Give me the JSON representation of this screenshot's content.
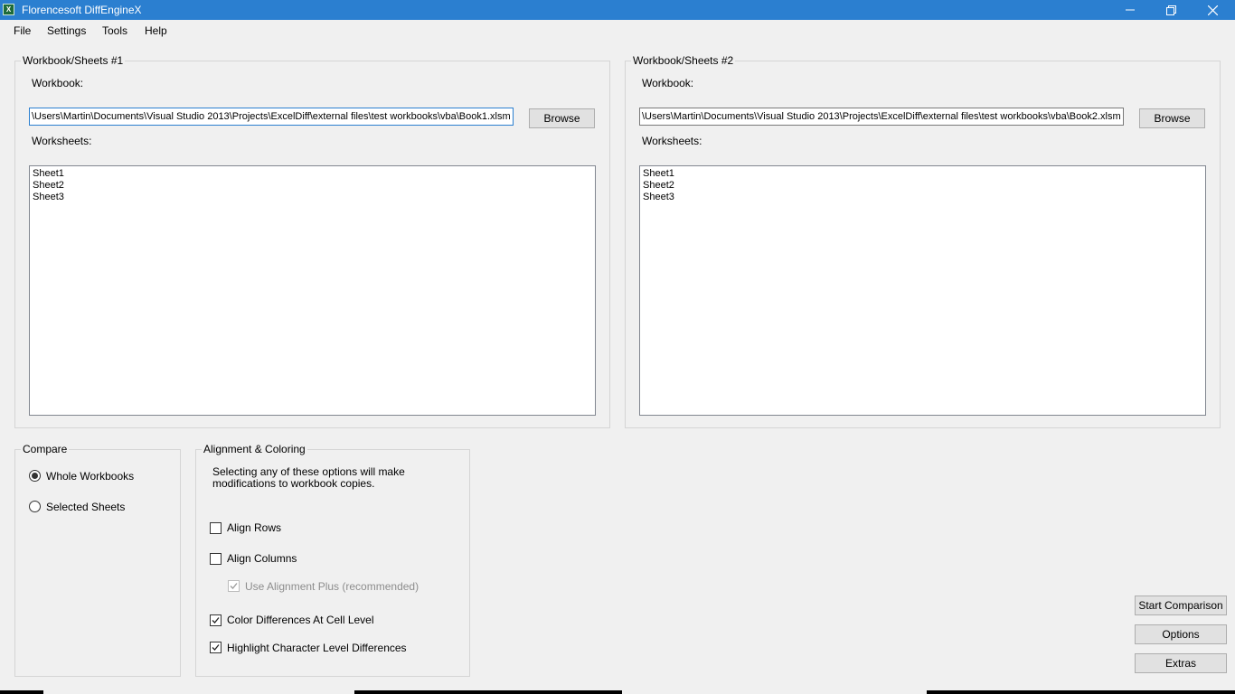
{
  "window": {
    "title": "Florencesoft DiffEngineX",
    "icon_name": "excel-app-icon",
    "controls": [
      "minimize-icon",
      "restore-icon",
      "close-icon"
    ]
  },
  "menu": {
    "items": [
      "File",
      "Settings",
      "Tools",
      "Help"
    ]
  },
  "workbook1": {
    "group_title": "Workbook/Sheets #1",
    "workbook_label": "Workbook:",
    "path": "\\Users\\Martin\\Documents\\Visual Studio 2013\\Projects\\ExcelDiff\\external files\\test workbooks\\vba\\Book1.xlsm",
    "browse_label": "Browse",
    "worksheets_label": "Worksheets:",
    "sheets": [
      "Sheet1",
      "Sheet2",
      "Sheet3"
    ]
  },
  "workbook2": {
    "group_title": "Workbook/Sheets #2",
    "workbook_label": "Workbook:",
    "path": "\\Users\\Martin\\Documents\\Visual Studio 2013\\Projects\\ExcelDiff\\external files\\test workbooks\\vba\\Book2.xlsm",
    "browse_label": "Browse",
    "worksheets_label": "Worksheets:",
    "sheets": [
      "Sheet1",
      "Sheet2",
      "Sheet3"
    ]
  },
  "compare": {
    "group_title": "Compare",
    "options": [
      {
        "label": "Whole Workbooks",
        "checked": true
      },
      {
        "label": "Selected Sheets",
        "checked": false
      }
    ]
  },
  "alignment": {
    "group_title": "Alignment & Coloring",
    "description_line1": "Selecting any of these options will make",
    "description_line2": "modifications to workbook copies.",
    "options": [
      {
        "label": "Align Rows",
        "checked": false,
        "enabled": true
      },
      {
        "label": "Align Columns",
        "checked": false,
        "enabled": true
      },
      {
        "label": "Use Alignment Plus (recommended)",
        "checked": true,
        "enabled": false
      },
      {
        "label": "Color Differences At Cell Level",
        "checked": true,
        "enabled": true
      },
      {
        "label": "Highlight Character Level Differences",
        "checked": true,
        "enabled": true
      }
    ]
  },
  "actions": {
    "start_label": "Start Comparison",
    "options_label": "Options",
    "extras_label": "Extras"
  },
  "colors": {
    "titlebar": "#2b7fd0",
    "window_bg": "#f0f0f0",
    "button_bg": "#e1e1e1",
    "focus_border": "#2b7fd0"
  }
}
